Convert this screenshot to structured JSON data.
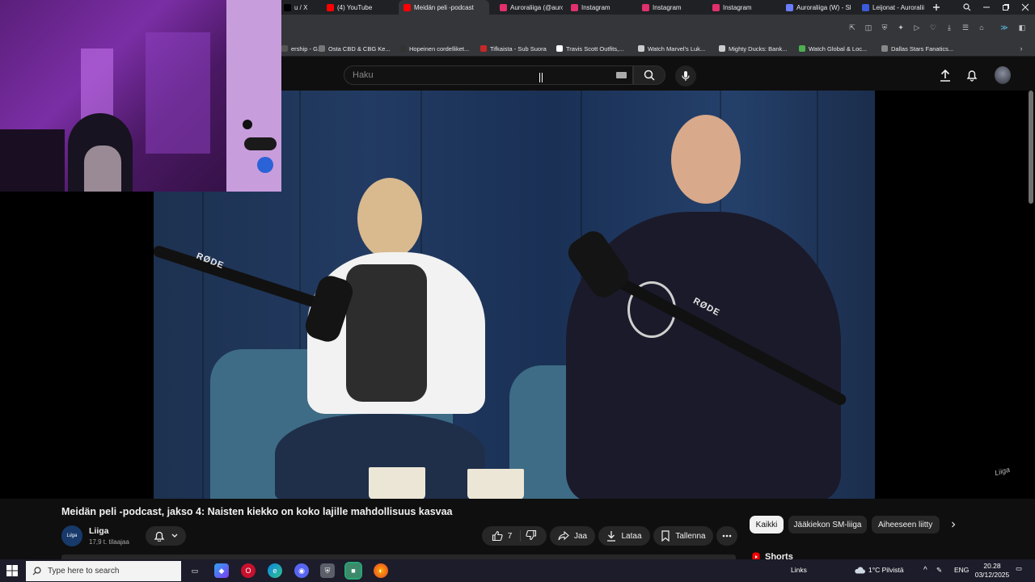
{
  "browser": {
    "tabs": [
      {
        "label": "u / X",
        "color": "#000000"
      },
      {
        "label": "(4) YouTube",
        "color": "#ff0000"
      },
      {
        "label": "Meidän peli -podcast",
        "color": "#ff0000"
      },
      {
        "label": "Auroraliiga (@auro",
        "color": "#e1306c"
      },
      {
        "label": "Instagram",
        "color": "#e1306c"
      },
      {
        "label": "Instagram",
        "color": "#e1306c"
      },
      {
        "label": "Instagram",
        "color": "#e1306c"
      },
      {
        "label": "Auroraliiga (W) - Sl",
        "color": "#6b7cff"
      },
      {
        "label": "Leijonat - Auroralii",
        "color": "#3b5bdb"
      }
    ],
    "bookmarks": [
      {
        "label": "ership - G...",
        "color": "#555555"
      },
      {
        "label": "Osta CBD & CBG Ke...",
        "color": "#777777"
      },
      {
        "label": "Hopeinen cordelliket...",
        "color": "#333333"
      },
      {
        "label": "Tifkaista - Sub Suora",
        "color": "#c62828"
      },
      {
        "label": "Travis Scott Outfits,...",
        "color": "#ffffff"
      },
      {
        "label": "Watch Marvel's Luk...",
        "color": "#cccccc"
      },
      {
        "label": "Mighty Ducks: Bank...",
        "color": "#cccccc"
      },
      {
        "label": "Watch Global & Loc...",
        "color": "#4caf50"
      },
      {
        "label": "Dallas Stars Fanatics...",
        "color": "#888888"
      }
    ]
  },
  "youtube": {
    "search_placeholder": "Haku",
    "video": {
      "title": "Meidän peli -podcast, jakso 4: Naisten kiekko on koko lajille mahdollisuus kasvaa",
      "rode_labels": [
        "RØDE",
        "RØDE"
      ],
      "watermark": "Liiga"
    },
    "channel": {
      "name": "Liiga",
      "subscribers": "17,9 t. tilaajaa",
      "avatar_text": "Liiga"
    },
    "actions": {
      "like_count": "7",
      "share": "Jaa",
      "download": "Lataa",
      "save": "Tallenna"
    },
    "chips": [
      "Kaikki",
      "Jääkiekon SM-liiga",
      "Aiheeseen liitty"
    ],
    "shorts_label": "Shorts"
  },
  "taskbar": {
    "search_placeholder": "Type here to search",
    "links": "Links",
    "weather": "1°C  Pilvistä",
    "language": "ENG",
    "time": "20.28",
    "date": "03/12/2025"
  },
  "colors": {
    "youtube_red": "#ff0000",
    "background": "#0f0f0f",
    "chip_active_bg": "#f1f1f1"
  }
}
